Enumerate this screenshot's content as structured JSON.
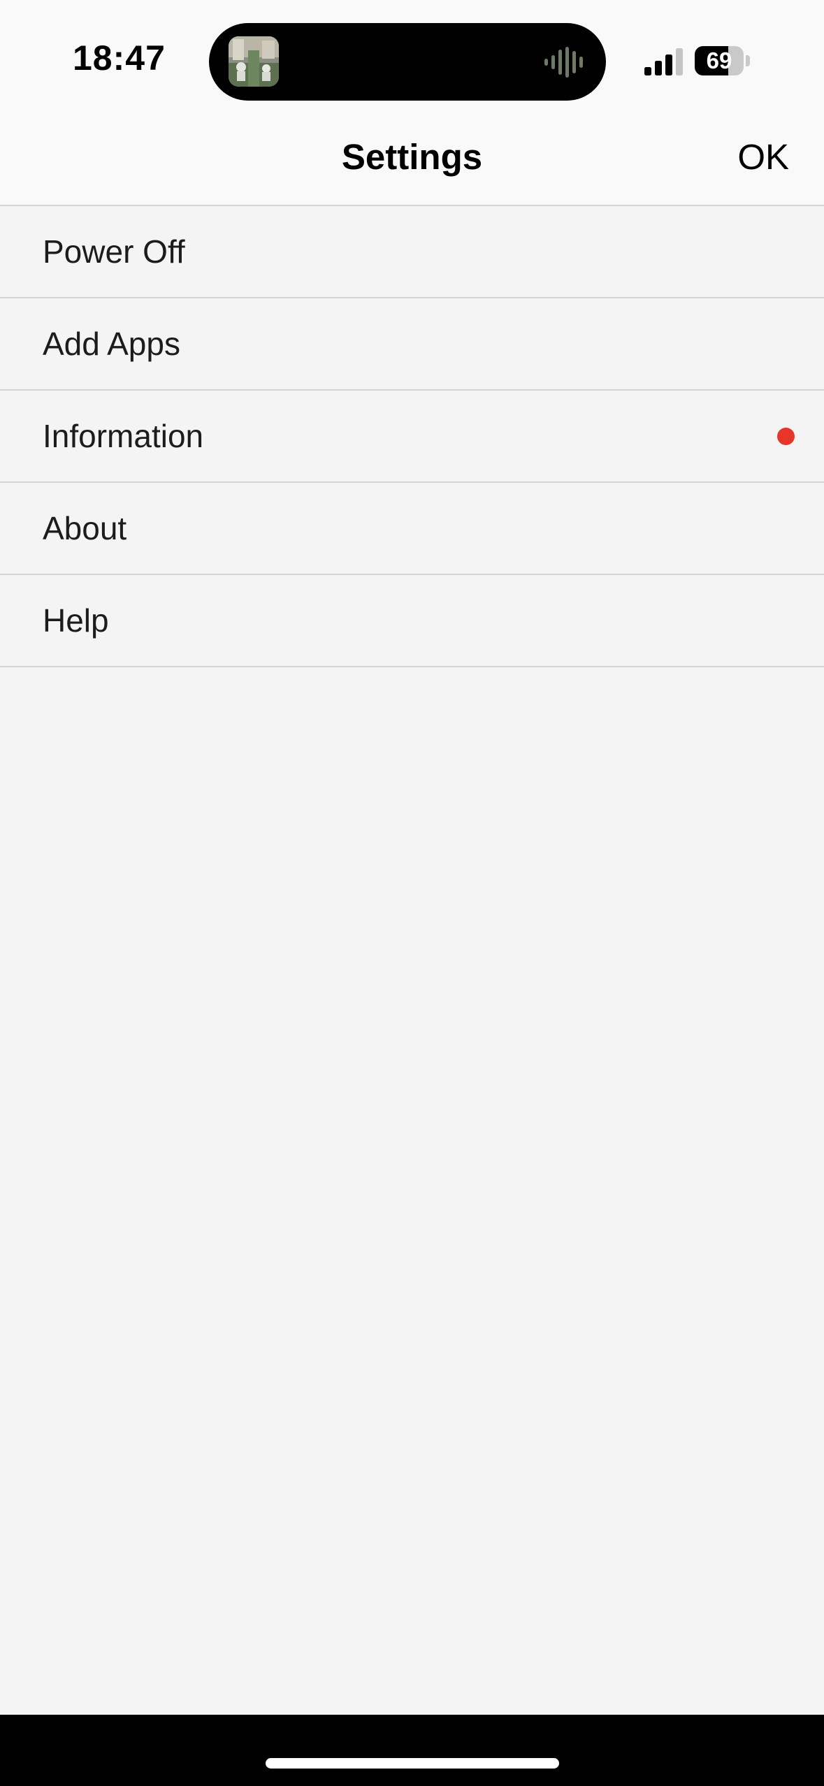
{
  "status_bar": {
    "time": "18:47",
    "battery_level": "69",
    "battery_fraction": 0.69,
    "cellular_bars_filled": 3,
    "cellular_bars_total": 4,
    "icons": {
      "island": "now-playing-artwork-icon",
      "audio": "audio-waveform-icon",
      "signal": "cellular-signal-icon",
      "battery": "battery-icon"
    }
  },
  "nav": {
    "title": "Settings",
    "ok_label": "OK"
  },
  "menu": {
    "items": [
      {
        "label": "Power Off",
        "badge": false
      },
      {
        "label": "Add Apps",
        "badge": false
      },
      {
        "label": "Information",
        "badge": true
      },
      {
        "label": "About",
        "badge": false
      },
      {
        "label": "Help",
        "badge": false
      }
    ]
  },
  "colors": {
    "background": "#f4f4f4",
    "bar_background": "#f9f9f9",
    "separator": "#d5d5d5",
    "badge": "#e8352a",
    "text": "#000000"
  }
}
